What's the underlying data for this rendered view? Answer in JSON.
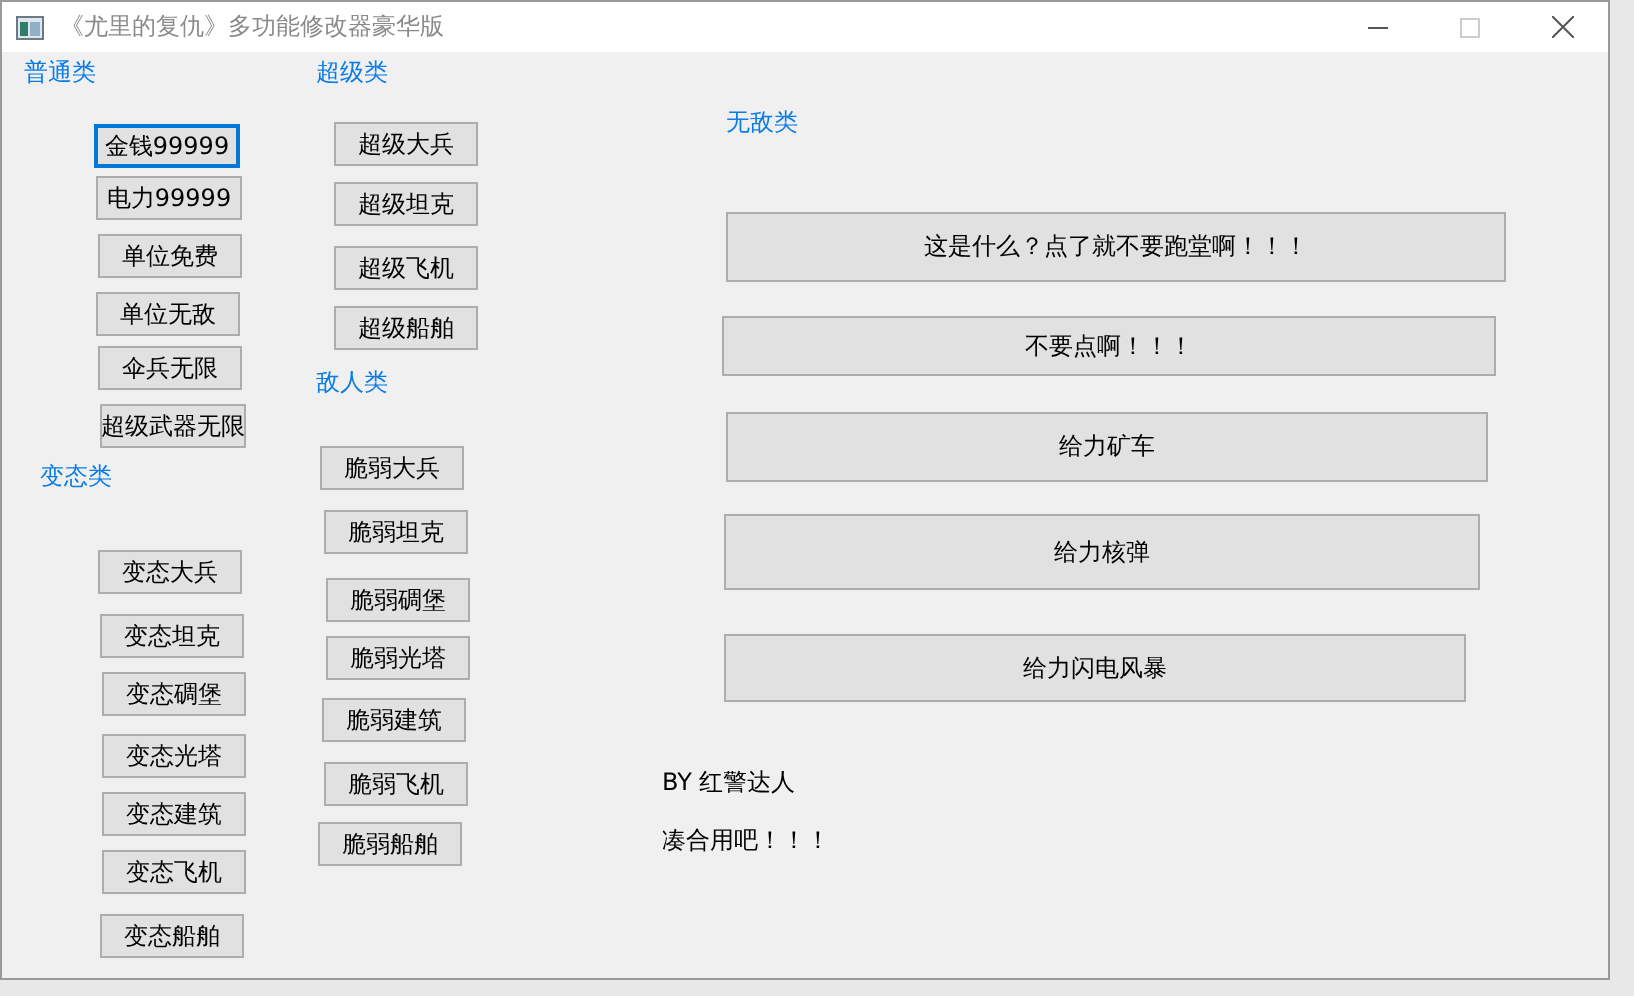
{
  "window": {
    "title": "《尤里的复仇》多功能修改器豪华版"
  },
  "groups": [
    {
      "title": "普通类",
      "buttons": [
        {
          "label": "金钱99999",
          "focused": true
        },
        {
          "label": "电力99999",
          "focused": false
        },
        {
          "label": "单位免费",
          "focused": false
        },
        {
          "label": "单位无敌",
          "focused": false
        },
        {
          "label": "伞兵无限",
          "focused": false
        },
        {
          "label": "超级武器无限",
          "focused": false
        }
      ]
    },
    {
      "title": "超级类",
      "buttons": [
        {
          "label": "超级大兵",
          "focused": false
        },
        {
          "label": "超级坦克",
          "focused": false
        },
        {
          "label": "超级飞机",
          "focused": false
        },
        {
          "label": "超级船舶",
          "focused": false
        }
      ]
    },
    {
      "title": "敌人类",
      "buttons": [
        {
          "label": "脆弱大兵",
          "focused": false
        },
        {
          "label": "脆弱坦克",
          "focused": false
        },
        {
          "label": "脆弱碉堡",
          "focused": false
        },
        {
          "label": "脆弱光塔",
          "focused": false
        },
        {
          "label": "脆弱建筑",
          "focused": false
        },
        {
          "label": "脆弱飞机",
          "focused": false
        },
        {
          "label": "脆弱船舶",
          "focused": false
        }
      ]
    },
    {
      "title": "变态类",
      "buttons": [
        {
          "label": "变态大兵",
          "focused": false
        },
        {
          "label": "变态坦克",
          "focused": false
        },
        {
          "label": "变态碉堡",
          "focused": false
        },
        {
          "label": "变态光塔",
          "focused": false
        },
        {
          "label": "变态建筑",
          "focused": false
        },
        {
          "label": "变态飞机",
          "focused": false
        },
        {
          "label": "变态船舶",
          "focused": false
        }
      ]
    },
    {
      "title": "无敌类",
      "buttons": [
        {
          "label": "这是什么？点了就不要跑堂啊！！！",
          "focused": false
        },
        {
          "label": "不要点啊！！！",
          "focused": false
        },
        {
          "label": "给力矿车",
          "focused": false
        },
        {
          "label": "给力核弹",
          "focused": false
        },
        {
          "label": "给力闪电风暴",
          "focused": false
        }
      ]
    }
  ],
  "notes": [
    "BY 红警达人",
    "凑合用吧！！！"
  ]
}
